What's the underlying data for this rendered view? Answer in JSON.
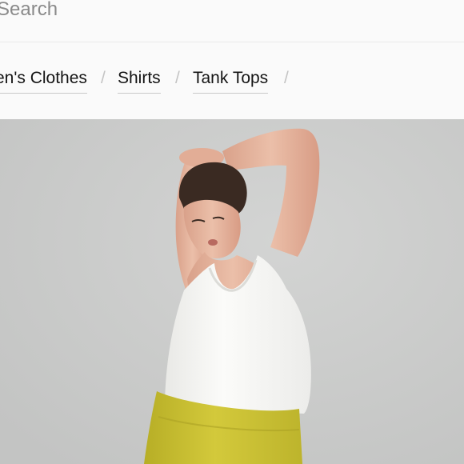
{
  "search": {
    "placeholder": "Search",
    "value": ""
  },
  "breadcrumb": {
    "items": [
      {
        "label": "en's Clothes"
      },
      {
        "label": "Shirts"
      },
      {
        "label": "Tank Tops"
      }
    ],
    "separator": "/"
  },
  "product_image": {
    "subject": "model wearing white racerback tank top and yellow leggings",
    "colors": {
      "background": "#cbcccb",
      "top": "#f7f7f5",
      "leggings": "#c9c033",
      "hair": "#3a2a22",
      "skin": "#e8b9a3"
    }
  }
}
